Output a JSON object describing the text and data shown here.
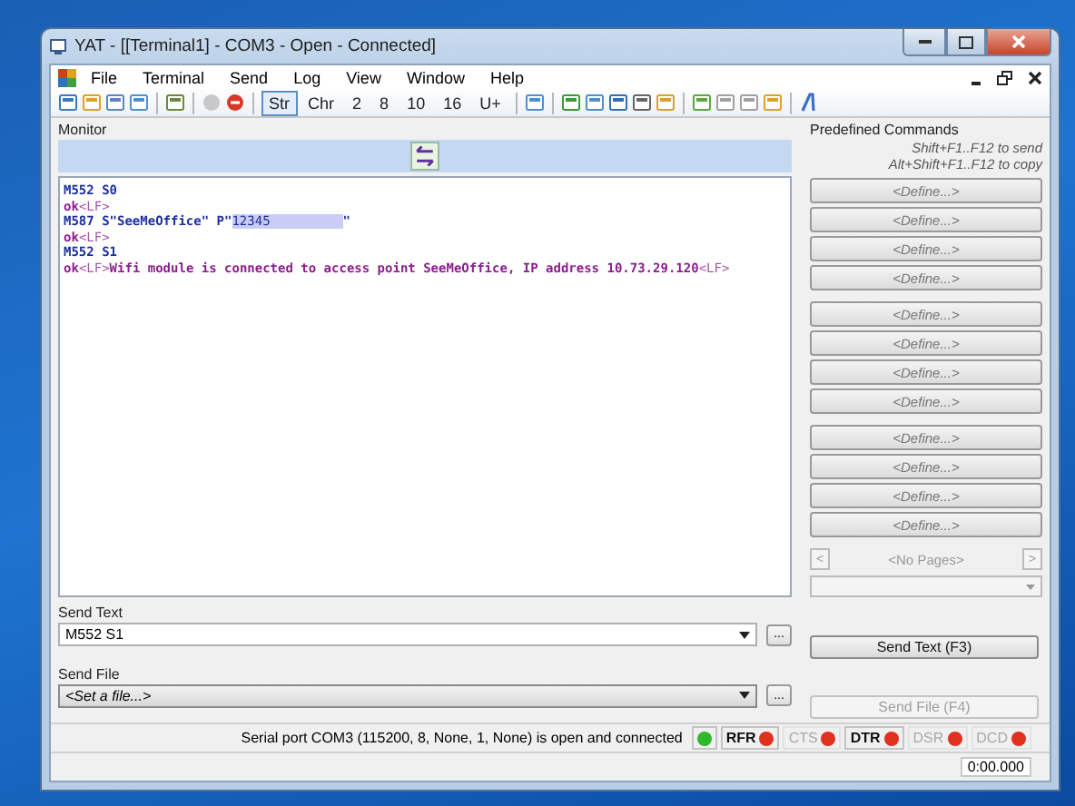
{
  "window": {
    "title": "YAT - [[Terminal1] - COM3 - Open - Connected]"
  },
  "menu": [
    "File",
    "Terminal",
    "Send",
    "Log",
    "View",
    "Window",
    "Help"
  ],
  "radix_buttons": [
    {
      "label": "Str",
      "selected": true
    },
    {
      "label": "Chr",
      "selected": false
    },
    {
      "label": "2",
      "selected": false
    },
    {
      "label": "8",
      "selected": false
    },
    {
      "label": "10",
      "selected": false
    },
    {
      "label": "16",
      "selected": false
    },
    {
      "label": "U+",
      "selected": false
    }
  ],
  "monitor": {
    "title": "Monitor",
    "lines": [
      {
        "kind": "tx",
        "segments": [
          {
            "kind": "text",
            "text": "M552 S0"
          }
        ]
      },
      {
        "kind": "rx",
        "segments": [
          {
            "kind": "text",
            "text": "ok"
          },
          {
            "kind": "control",
            "text": "<LF>"
          }
        ]
      },
      {
        "kind": "tx",
        "segments": [
          {
            "kind": "text",
            "text": "M587 S\"SeeMeOffice\" P\""
          },
          {
            "kind": "highlight",
            "text": "12345"
          },
          {
            "kind": "text",
            "text": "\""
          }
        ]
      },
      {
        "kind": "rx",
        "segments": [
          {
            "kind": "text",
            "text": "ok"
          },
          {
            "kind": "control",
            "text": "<LF>"
          }
        ]
      },
      {
        "kind": "tx",
        "segments": [
          {
            "kind": "text",
            "text": "M552 S1"
          }
        ]
      },
      {
        "kind": "rx",
        "segments": [
          {
            "kind": "text",
            "text": "ok"
          },
          {
            "kind": "control",
            "text": "<LF>"
          },
          {
            "kind": "text",
            "text": "Wifi module is connected to access point SeeMeOffice, IP address 10.73.29.120"
          },
          {
            "kind": "control",
            "text": "<LF>"
          }
        ]
      }
    ]
  },
  "predefined": {
    "title": "Predefined Commands",
    "hints": [
      "Shift+F1..F12 to send",
      "Alt+Shift+F1..F12 to copy"
    ],
    "groups": [
      [
        "<Define...>",
        "<Define...>",
        "<Define...>",
        "<Define...>"
      ],
      [
        "<Define...>",
        "<Define...>",
        "<Define...>",
        "<Define...>"
      ],
      [
        "<Define...>",
        "<Define...>",
        "<Define...>",
        "<Define...>"
      ]
    ],
    "prev_page": "<",
    "page_label": "<No Pages>",
    "next_page": ">"
  },
  "send_text": {
    "title": "Send Text",
    "value": "M552 S1",
    "browse": "...",
    "button": "Send Text (F3)",
    "button_disabled": false
  },
  "send_file": {
    "title": "Send File",
    "value": "<Set a file...>",
    "browse": "...",
    "button": "Send File (F4)",
    "button_disabled": true
  },
  "status": {
    "message": "Serial port COM3 (115200, 8, None, 1, None) is open and connected",
    "leds": [
      {
        "color": "#2eb82e"
      },
      {
        "label": "RFR",
        "color": "#e0301e",
        "disabled": false,
        "bold": true
      },
      {
        "label": "CTS",
        "color": "#e0301e",
        "disabled": true,
        "bold": false
      },
      {
        "label": "DTR",
        "color": "#e0301e",
        "disabled": false,
        "bold": true
      },
      {
        "label": "DSR",
        "color": "#e0301e",
        "disabled": true,
        "bold": false
      },
      {
        "label": "DCD",
        "color": "#e0301e",
        "disabled": true,
        "bold": false
      }
    ],
    "timer": "0:00.000"
  }
}
